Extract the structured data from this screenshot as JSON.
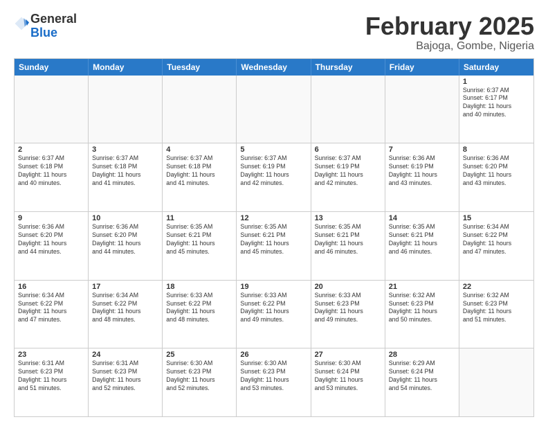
{
  "header": {
    "logo_general": "General",
    "logo_blue": "Blue",
    "month_title": "February 2025",
    "location": "Bajoga, Gombe, Nigeria"
  },
  "days_of_week": [
    "Sunday",
    "Monday",
    "Tuesday",
    "Wednesday",
    "Thursday",
    "Friday",
    "Saturday"
  ],
  "weeks": [
    [
      {
        "day": "",
        "info": ""
      },
      {
        "day": "",
        "info": ""
      },
      {
        "day": "",
        "info": ""
      },
      {
        "day": "",
        "info": ""
      },
      {
        "day": "",
        "info": ""
      },
      {
        "day": "",
        "info": ""
      },
      {
        "day": "1",
        "info": "Sunrise: 6:37 AM\nSunset: 6:17 PM\nDaylight: 11 hours\nand 40 minutes."
      }
    ],
    [
      {
        "day": "2",
        "info": "Sunrise: 6:37 AM\nSunset: 6:18 PM\nDaylight: 11 hours\nand 40 minutes."
      },
      {
        "day": "3",
        "info": "Sunrise: 6:37 AM\nSunset: 6:18 PM\nDaylight: 11 hours\nand 41 minutes."
      },
      {
        "day": "4",
        "info": "Sunrise: 6:37 AM\nSunset: 6:18 PM\nDaylight: 11 hours\nand 41 minutes."
      },
      {
        "day": "5",
        "info": "Sunrise: 6:37 AM\nSunset: 6:19 PM\nDaylight: 11 hours\nand 42 minutes."
      },
      {
        "day": "6",
        "info": "Sunrise: 6:37 AM\nSunset: 6:19 PM\nDaylight: 11 hours\nand 42 minutes."
      },
      {
        "day": "7",
        "info": "Sunrise: 6:36 AM\nSunset: 6:19 PM\nDaylight: 11 hours\nand 43 minutes."
      },
      {
        "day": "8",
        "info": "Sunrise: 6:36 AM\nSunset: 6:20 PM\nDaylight: 11 hours\nand 43 minutes."
      }
    ],
    [
      {
        "day": "9",
        "info": "Sunrise: 6:36 AM\nSunset: 6:20 PM\nDaylight: 11 hours\nand 44 minutes."
      },
      {
        "day": "10",
        "info": "Sunrise: 6:36 AM\nSunset: 6:20 PM\nDaylight: 11 hours\nand 44 minutes."
      },
      {
        "day": "11",
        "info": "Sunrise: 6:35 AM\nSunset: 6:21 PM\nDaylight: 11 hours\nand 45 minutes."
      },
      {
        "day": "12",
        "info": "Sunrise: 6:35 AM\nSunset: 6:21 PM\nDaylight: 11 hours\nand 45 minutes."
      },
      {
        "day": "13",
        "info": "Sunrise: 6:35 AM\nSunset: 6:21 PM\nDaylight: 11 hours\nand 46 minutes."
      },
      {
        "day": "14",
        "info": "Sunrise: 6:35 AM\nSunset: 6:21 PM\nDaylight: 11 hours\nand 46 minutes."
      },
      {
        "day": "15",
        "info": "Sunrise: 6:34 AM\nSunset: 6:22 PM\nDaylight: 11 hours\nand 47 minutes."
      }
    ],
    [
      {
        "day": "16",
        "info": "Sunrise: 6:34 AM\nSunset: 6:22 PM\nDaylight: 11 hours\nand 47 minutes."
      },
      {
        "day": "17",
        "info": "Sunrise: 6:34 AM\nSunset: 6:22 PM\nDaylight: 11 hours\nand 48 minutes."
      },
      {
        "day": "18",
        "info": "Sunrise: 6:33 AM\nSunset: 6:22 PM\nDaylight: 11 hours\nand 48 minutes."
      },
      {
        "day": "19",
        "info": "Sunrise: 6:33 AM\nSunset: 6:22 PM\nDaylight: 11 hours\nand 49 minutes."
      },
      {
        "day": "20",
        "info": "Sunrise: 6:33 AM\nSunset: 6:23 PM\nDaylight: 11 hours\nand 49 minutes."
      },
      {
        "day": "21",
        "info": "Sunrise: 6:32 AM\nSunset: 6:23 PM\nDaylight: 11 hours\nand 50 minutes."
      },
      {
        "day": "22",
        "info": "Sunrise: 6:32 AM\nSunset: 6:23 PM\nDaylight: 11 hours\nand 51 minutes."
      }
    ],
    [
      {
        "day": "23",
        "info": "Sunrise: 6:31 AM\nSunset: 6:23 PM\nDaylight: 11 hours\nand 51 minutes."
      },
      {
        "day": "24",
        "info": "Sunrise: 6:31 AM\nSunset: 6:23 PM\nDaylight: 11 hours\nand 52 minutes."
      },
      {
        "day": "25",
        "info": "Sunrise: 6:30 AM\nSunset: 6:23 PM\nDaylight: 11 hours\nand 52 minutes."
      },
      {
        "day": "26",
        "info": "Sunrise: 6:30 AM\nSunset: 6:23 PM\nDaylight: 11 hours\nand 53 minutes."
      },
      {
        "day": "27",
        "info": "Sunrise: 6:30 AM\nSunset: 6:24 PM\nDaylight: 11 hours\nand 53 minutes."
      },
      {
        "day": "28",
        "info": "Sunrise: 6:29 AM\nSunset: 6:24 PM\nDaylight: 11 hours\nand 54 minutes."
      },
      {
        "day": "",
        "info": ""
      }
    ]
  ]
}
